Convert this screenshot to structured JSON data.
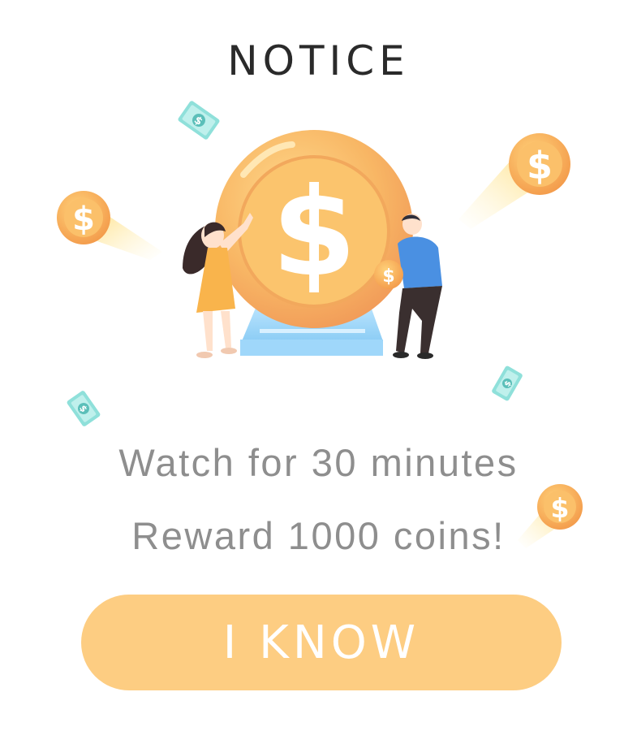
{
  "dialog": {
    "title": "NOTICE",
    "line1": "Watch for 30 minutes",
    "line2": "Reward 1000 coins!",
    "button_label": "I KNOW"
  },
  "icons": {
    "big_coin_symbol": "$",
    "small_coin_symbol": "$",
    "bill_symbol": "$"
  },
  "colors": {
    "button_bg": "#fdcd82",
    "button_text": "#ffffff",
    "title_text": "#2a2a2a",
    "body_text": "#8e8e8e",
    "coin_gold": "#f8b765",
    "bill_teal": "#7ed9d3"
  }
}
